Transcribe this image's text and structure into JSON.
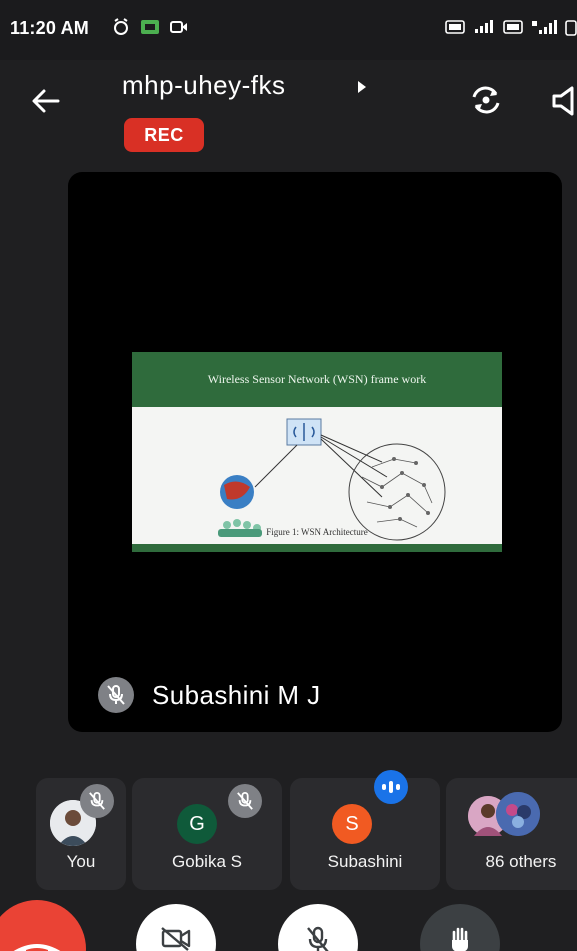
{
  "status_bar": {
    "time": "11:20 AM",
    "left_icons": [
      "alarm-icon",
      "gallery-icon",
      "record-icon"
    ],
    "right_icons": [
      "volte-icon",
      "signal-icon",
      "volte-icon",
      "signal-4g-icon",
      "battery-icon"
    ]
  },
  "header": {
    "meeting_code": "mhp-uhey-fks",
    "rec_label": "REC",
    "icons": [
      "back-arrow-icon",
      "switch-camera-icon",
      "speaker-icon"
    ]
  },
  "main_tile": {
    "slide_title": "Wireless Sensor Network (WSN) frame work",
    "slide_caption": "Figure 1: WSN Architecture",
    "speaker_name": "Subashini M J",
    "mic_state": "muted"
  },
  "participants": [
    {
      "label": "You",
      "avatar": "photo",
      "mic": "muted"
    },
    {
      "label": "Gobika S",
      "initial": "G",
      "mic": "muted"
    },
    {
      "label": "Subashini",
      "initial": "S",
      "mic": "speaking"
    },
    {
      "label": "86 others",
      "avatar": "group-photos"
    }
  ],
  "controls": {
    "icons": [
      "end-call-icon",
      "camera-off-icon",
      "mic-off-icon",
      "raise-hand-icon"
    ]
  },
  "colors": {
    "background": "#1f1f21",
    "tile": "#2b2b2e",
    "rec": "#d93025",
    "accent_blue": "#1a73e8",
    "end_call": "#ea4335",
    "avatar_gobika": "#0f5a3a",
    "avatar_subashini": "#f15a22"
  }
}
